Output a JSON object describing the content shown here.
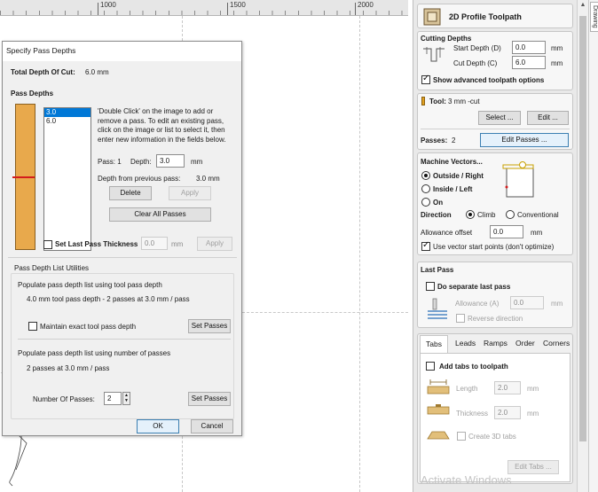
{
  "ruler": {
    "labels": [
      "1000",
      "1500",
      "2000"
    ]
  },
  "dialog": {
    "title": "Specify Pass Depths",
    "total_depth_label": "Total Depth Of Cut:",
    "total_depth_value": "6.0 mm",
    "pass_depths_heading": "Pass Depths",
    "list_items": [
      "3.0",
      "6.0"
    ],
    "help_text": [
      "'Double Click' on the image to add or",
      "remove a pass. To edit an existing pass,",
      "click on the image or list to select it, then",
      "enter new information in the fields below."
    ],
    "pass_label": "Pass: 1",
    "depth_label": "Depth:",
    "depth_value": "3.0",
    "depth_unit": "mm",
    "depth_from_prev_label": "Depth from previous pass:",
    "depth_from_prev_value": "3.0 mm",
    "delete_label": "Delete",
    "apply_label": "Apply",
    "clear_all_label": "Clear All Passes",
    "set_last_label": "Set Last Pass Thickness",
    "set_last_value": "0.0",
    "set_last_unit": "mm",
    "set_last_apply": "Apply",
    "utilities_heading": "Pass Depth List Utilities",
    "populate_tool_label": "Populate pass depth list using tool pass depth",
    "tool_pass_info": "4.0 mm tool pass depth - 2 passes at 3.0 mm / pass",
    "maintain_label": "Maintain exact tool pass depth",
    "set_passes_label": "Set Passes",
    "populate_number_label": "Populate pass depth list using number of passes",
    "number_info": "2 passes at 3.0 mm / pass",
    "number_of_passes_label": "Number Of Passes:",
    "number_of_passes_value": "2",
    "set_passes_label2": "Set Passes",
    "ok_label": "OK",
    "cancel_label": "Cancel"
  },
  "panel": {
    "title": "2D Profile Toolpath",
    "cutting_depths": {
      "heading": "Cutting Depths",
      "start_label": "Start Depth (D)",
      "start_value": "0.0",
      "start_unit": "mm",
      "cut_label": "Cut Depth (C)",
      "cut_value": "6.0",
      "cut_unit": "mm",
      "show_advanced": "Show advanced toolpath options"
    },
    "tool": {
      "label": "Tool:",
      "value": "3 mm -cut",
      "select_label": "Select ...",
      "edit_label": "Edit ...",
      "passes_label": "Passes:",
      "passes_value": "2",
      "edit_passes_label": "Edit Passes ..."
    },
    "machine_vectors": {
      "heading": "Machine Vectors...",
      "outside": "Outside / Right",
      "inside": "Inside / Left",
      "on": "On",
      "direction_label": "Direction",
      "climb": "Climb",
      "conventional": "Conventional",
      "allowance_label": "Allowance offset",
      "allowance_value": "0.0",
      "allowance_unit": "mm",
      "use_vector_start": "Use vector start points (don't optimize)"
    },
    "last_pass": {
      "heading": "Last Pass",
      "do_separate": "Do separate last pass",
      "allowance_label": "Allowance (A)",
      "allowance_value": "0.0",
      "allowance_unit": "mm",
      "reverse": "Reverse direction"
    },
    "tabs": {
      "items": [
        "Tabs",
        "Leads",
        "Ramps",
        "Order",
        "Corners"
      ],
      "add_tabs": "Add tabs to toolpath",
      "length_label": "Length",
      "length_value": "2.0",
      "length_unit": "mm",
      "thickness_label": "Thickness",
      "thickness_value": "2.0",
      "thickness_unit": "mm",
      "create_3d": "Create 3D tabs",
      "edit_tabs": "Edit Tabs ..."
    },
    "side_tab_label": "Drawing"
  },
  "watermark": "Activate Windows",
  "colors": {
    "bar_fill": "#e8a94c",
    "pass_line": "#d41c1c",
    "selection": "#0078d7"
  }
}
